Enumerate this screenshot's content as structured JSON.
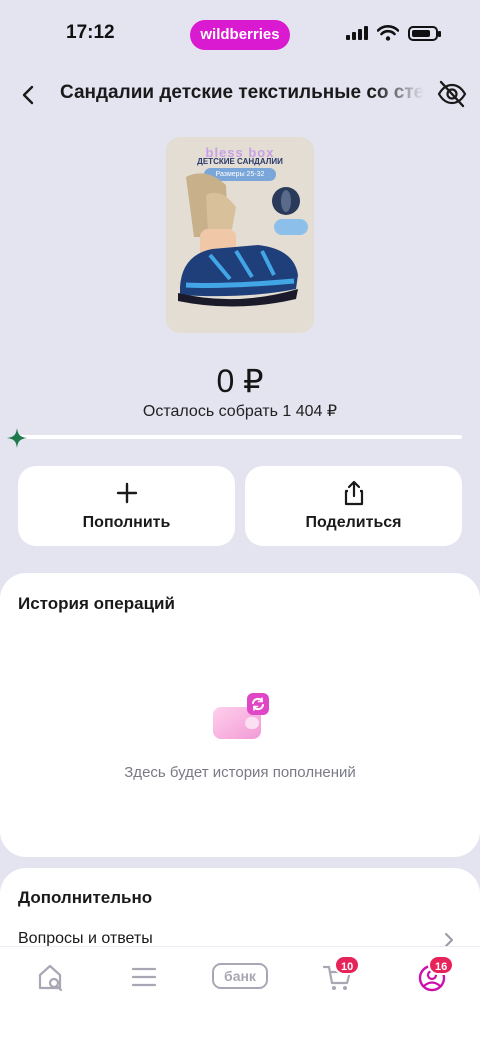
{
  "status_bar": {
    "time": "17:12",
    "brand": "wildberries",
    "battery_level": 0.8,
    "brand_color": "#d91ad0"
  },
  "header": {
    "title": "Сандалии детские текстильные со стел",
    "back_icon": "chevron-left-icon",
    "hide_icon": "eye-off-icon"
  },
  "product": {
    "image_brand_text": "bless box",
    "image_title_text": "ДЕТСКИЕ САНДАЛИИ",
    "image_sizes_text": "Размеры 25-32"
  },
  "balance": {
    "amount": "0 ₽",
    "remaining": "Осталось собрать 1 404 ₽",
    "progress": 0
  },
  "actions": {
    "topup_label": "Пополнить",
    "share_label": "Поделиться"
  },
  "history": {
    "title": "История операций",
    "empty_text": "Здесь будет история пополнений"
  },
  "extra": {
    "title": "Дополнительно",
    "faq_label": "Вопросы и ответы"
  },
  "bottom_nav": {
    "bank_label": "банк",
    "cart_badge": "10",
    "profile_badge": "16",
    "accent_color": "#cb11ab",
    "badge_color": "#e6245a"
  }
}
